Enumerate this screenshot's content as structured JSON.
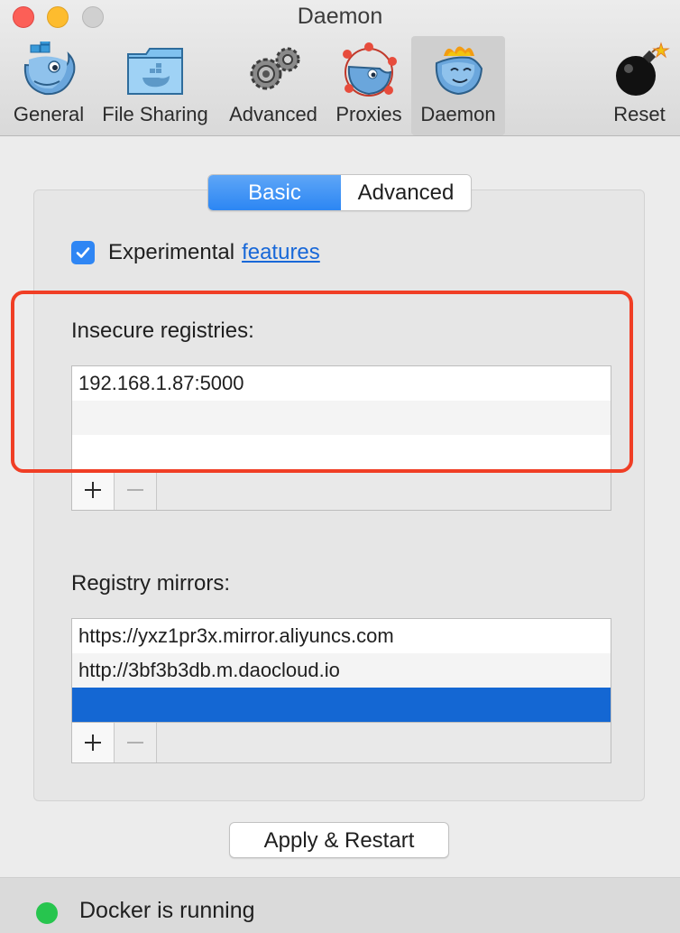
{
  "window": {
    "title": "Daemon"
  },
  "toolbar": {
    "items": [
      {
        "label": "General",
        "icon": "docker-whale-icon"
      },
      {
        "label": "File Sharing",
        "icon": "folder-whale-icon"
      },
      {
        "label": "Advanced",
        "icon": "gears-icon"
      },
      {
        "label": "Proxies",
        "icon": "proxies-whale-icon"
      },
      {
        "label": "Daemon",
        "icon": "daemon-whale-icon",
        "selected": true
      },
      {
        "label": "Reset",
        "icon": "bomb-icon"
      }
    ]
  },
  "tabs": {
    "basic": "Basic",
    "advanced": "Advanced",
    "selected": "Basic"
  },
  "experimental": {
    "checked": true,
    "label": "Experimental",
    "link": "features"
  },
  "insecure": {
    "label": "Insecure registries:",
    "items": [
      "192.168.1.87:5000"
    ]
  },
  "mirrors": {
    "label": "Registry mirrors:",
    "items": [
      "https://yxz1pr3x.mirror.aliyuncs.com",
      "http://3bf3b3db.m.daocloud.io"
    ]
  },
  "apply_label": "Apply & Restart",
  "status": {
    "text": "Docker is running",
    "color": "#27c54e"
  },
  "colors": {
    "accent": "#2f86f4",
    "selection": "#1467d3",
    "highlight": "#f03e25"
  }
}
